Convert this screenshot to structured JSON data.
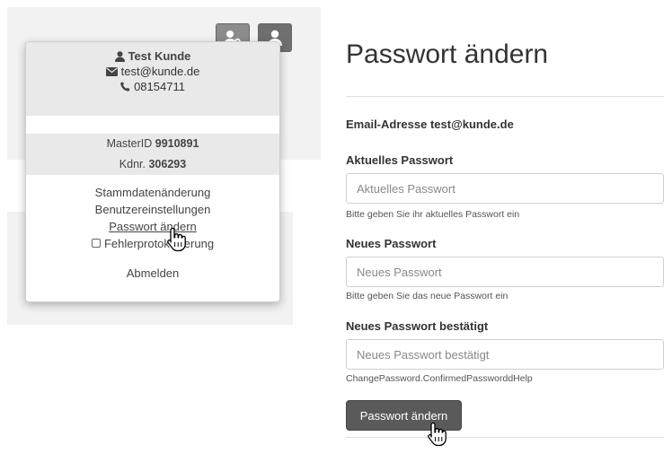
{
  "toolbar": {
    "settings_icon": "user-gear-icon",
    "user_icon": "user-icon"
  },
  "user_menu": {
    "name": "Test Kunde",
    "email": "test@kunde.de",
    "phone": "08154711",
    "master_id_label": "MasterID",
    "master_id": "9910891",
    "customer_no_label": "Kdnr.",
    "customer_no": "306293",
    "links": {
      "master_data": "Stammdatenänderung",
      "user_settings": "Benutzereinstellungen",
      "change_password": "Passwort ändern",
      "error_logging": "Fehlerprotokollierung",
      "logout": "Abmelden"
    },
    "error_logging_checked": false
  },
  "form": {
    "title": "Passwort ändern",
    "email_label": "Email-Adresse",
    "email_value": "test@kunde.de",
    "current": {
      "label": "Aktuelles Passwort",
      "placeholder": "Aktuelles Passwort",
      "value": "",
      "help": "Bitte geben Sie ihr aktuelles Passwort ein"
    },
    "new": {
      "label": "Neues Passwort",
      "placeholder": "Neues Passwort",
      "value": "",
      "help": "Bitte geben Sie das neue Passwort ein"
    },
    "confirm": {
      "label": "Neues Passwort bestätigt",
      "placeholder": "Neues Passwort bestätigt",
      "value": "",
      "help": "ChangePassword.ConfirmedPassworddHelp"
    },
    "submit_label": "Passwort ändern"
  },
  "colors": {
    "button_bg": "#5a5a5a",
    "panel_bg": "#f2f2f2",
    "menu_head_bg": "#e9e9e9"
  }
}
